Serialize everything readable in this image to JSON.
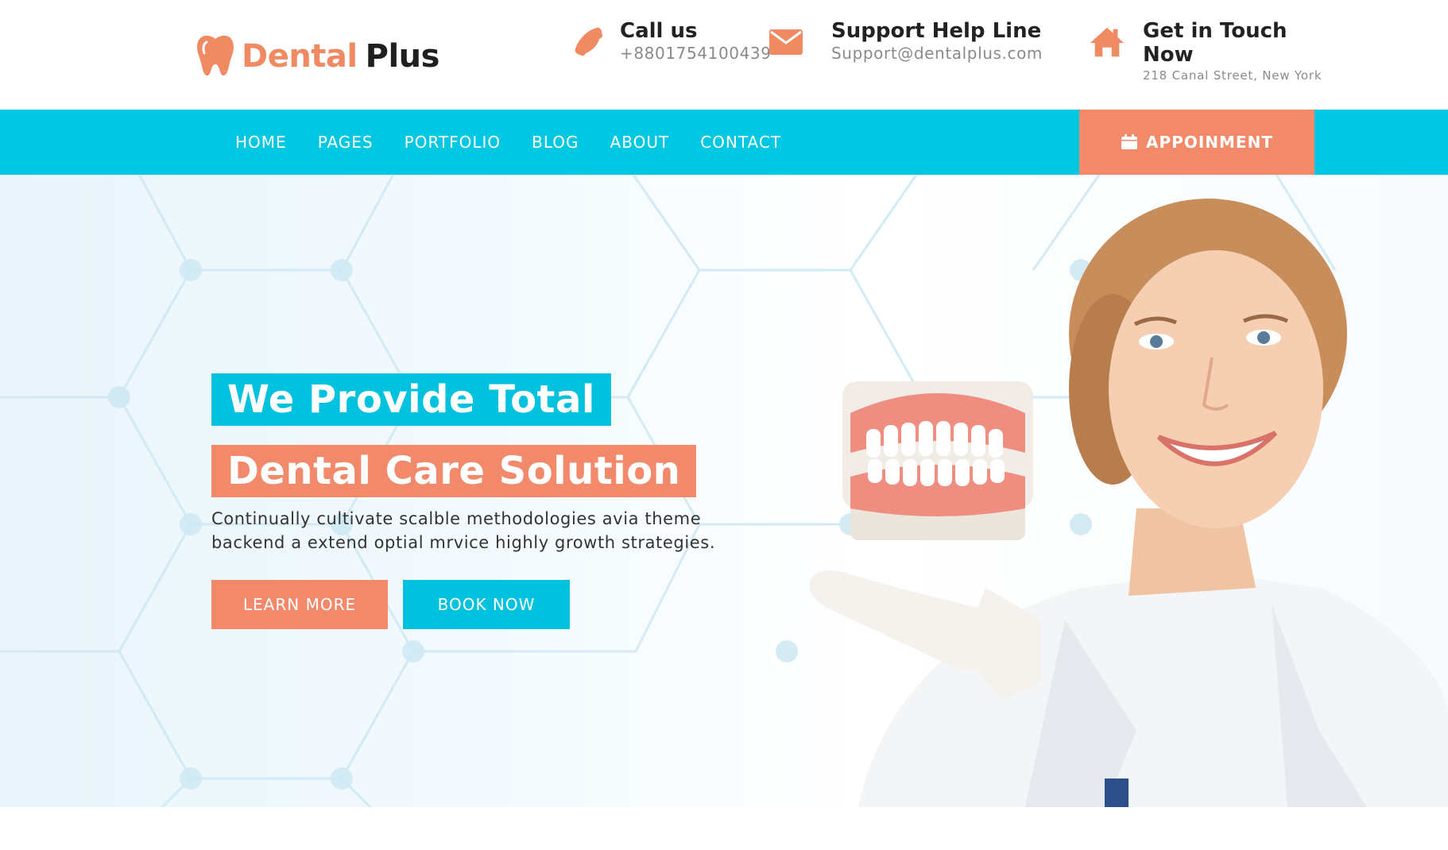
{
  "brand": {
    "name_part1": "Dental",
    "name_part2": "Plus",
    "accent": "#f08a62",
    "primary": "#00c7e2"
  },
  "header": {
    "call": {
      "icon": "phone-icon",
      "title": "Call us",
      "value": "+8801754100439"
    },
    "support": {
      "icon": "envelope-icon",
      "title": "Support Help Line",
      "value": "Support@dentalplus.com"
    },
    "touch": {
      "icon": "home-icon",
      "title_line1": "Get in Touch",
      "title_line2": "Now",
      "value": "218 Canal Street, New York"
    }
  },
  "nav": {
    "items": [
      {
        "label": "HOME"
      },
      {
        "label": "PAGES"
      },
      {
        "label": "PORTFOLIO"
      },
      {
        "label": "BLOG"
      },
      {
        "label": "ABOUT"
      },
      {
        "label": "CONTACT"
      }
    ],
    "appointment": {
      "icon": "calendar-icon",
      "label": "APPOINMENT"
    }
  },
  "hero": {
    "headline_1": "We Provide Total",
    "headline_2": "Dental Care Solution",
    "description_line1": "Continually cultivate scalble methodologies avia theme",
    "description_line2": "backend a extend optial mrvice highly growth strategies.",
    "learn_more": "LEARN MORE",
    "book_now": "BOOK NOW"
  }
}
